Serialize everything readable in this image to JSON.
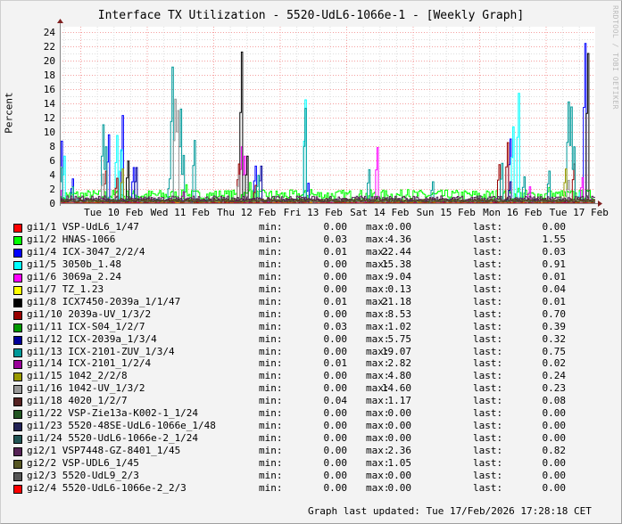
{
  "chart_data": {
    "type": "line",
    "title": "Interface TX Utilization - 5520-UdL6-1066e-1 - [Weekly Graph]",
    "ylabel": "Percent",
    "xlabel": "",
    "watermark": "RRDTOOL / TOBI OETIKER",
    "ylim": [
      0,
      25
    ],
    "yticks": [
      "0",
      "2",
      "4",
      "6",
      "8",
      "10",
      "12",
      "14",
      "16",
      "18",
      "20",
      "22",
      "24"
    ],
    "x_unit": "hours since Tue 10 Feb 00:00",
    "xlim": [
      -7.4,
      185.5
    ],
    "xticks": [
      {
        "label": "Tue 10 Feb",
        "hour": 12
      },
      {
        "label": "Wed 11 Feb",
        "hour": 36
      },
      {
        "label": "Thu 12 Feb",
        "hour": 60
      },
      {
        "label": "Fri 13 Feb",
        "hour": 84
      },
      {
        "label": "Sat 14 Feb",
        "hour": 108
      },
      {
        "label": "Sun 15 Feb",
        "hour": 132
      },
      {
        "label": "Mon 16 Feb",
        "hour": 156
      },
      {
        "label": "Tue 17 Feb",
        "hour": 180
      }
    ],
    "grid": true,
    "legend_placement": "bottom",
    "series": [
      {
        "name": "gi1/1 VSP-UdL6_1/47",
        "color": "#FF0000",
        "min": "0.00",
        "max": "0.00",
        "last": "0.00",
        "base": 0,
        "spikes": []
      },
      {
        "name": "gi1/2 HNAS-1066",
        "color": "#00FF00",
        "min": "0.03",
        "max": "4.36",
        "last": "1.55",
        "base": 1.1,
        "spikes": [
          [
            38,
            2.6
          ],
          [
            61,
            2.9
          ],
          [
            83,
            1.9
          ],
          [
            118,
            1.9
          ],
          [
            158,
            2.1
          ],
          [
            169,
            2.2
          ]
        ]
      },
      {
        "name": "gi1/4 ICX-3047_2/2/4",
        "color": "#0000FF",
        "min": "0.01",
        "max": "22.44",
        "last": "0.03",
        "base": 0.1,
        "spikes": [
          [
            -7,
            8.7
          ],
          [
            -3,
            3.4
          ],
          [
            10,
            9.6
          ],
          [
            15,
            12.3
          ],
          [
            19,
            5.0
          ],
          [
            63,
            5.2
          ],
          [
            82,
            2.8
          ],
          [
            155,
            9.0
          ],
          [
            182,
            22.4
          ]
        ]
      },
      {
        "name": "gi1/5 3050b_1.48",
        "color": "#00FFFF",
        "min": "0.00",
        "max": "15.38",
        "last": "0.91",
        "base": 0.1,
        "spikes": [
          [
            -6,
            6.6
          ],
          [
            13,
            9.5
          ],
          [
            14.5,
            7.5
          ],
          [
            81,
            14.5
          ],
          [
            156,
            10.7
          ],
          [
            158,
            15.4
          ],
          [
            180,
            1.5
          ]
        ]
      },
      {
        "name": "gi1/6 3069a_2.24",
        "color": "#FF00FF",
        "min": "0.00",
        "max": "9.04",
        "last": "0.01",
        "base": 0.2,
        "spikes": [
          [
            -7,
            1.8
          ],
          [
            58,
            7.9
          ],
          [
            59,
            6.6
          ],
          [
            107,
            7.8
          ],
          [
            162,
            2.3
          ],
          [
            181,
            3.6
          ]
        ]
      },
      {
        "name": "gi1/7 TZ_1.23",
        "color": "#FFFF00",
        "min": "0.00",
        "max": "0.13",
        "last": "0.04",
        "base": 0.05,
        "spikes": []
      },
      {
        "name": "gi1/8 ICX7450-2039a_1/1/47",
        "color": "#000000",
        "min": "0.01",
        "max": "21.18",
        "last": "0.01",
        "base": 0.2,
        "spikes": [
          [
            17,
            5.9
          ],
          [
            58,
            21.2
          ],
          [
            60,
            6.6
          ],
          [
            183,
            21.0
          ]
        ]
      },
      {
        "name": "gi1/10 2039a-UV_1/3/2",
        "color": "#990000",
        "min": "0.00",
        "max": "8.53",
        "last": "0.70",
        "base": 0.3,
        "spikes": [
          [
            9,
            4.5
          ],
          [
            13,
            3.5
          ],
          [
            57,
            5.5
          ],
          [
            63,
            2.5
          ],
          [
            151,
            5.4
          ],
          [
            154,
            8.5
          ],
          [
            178,
            5.5
          ]
        ]
      },
      {
        "name": "gi1/11 ICX-S04_1/2/7",
        "color": "#009900",
        "min": "0.03",
        "max": "1.02",
        "last": "0.39",
        "base": 0.35,
        "spikes": []
      },
      {
        "name": "gi1/12 ICX-2039a_1/3/4",
        "color": "#000099",
        "min": "0.00",
        "max": "5.75",
        "last": "0.32",
        "base": 0.3,
        "spikes": [
          [
            20,
            5.0
          ],
          [
            65,
            5.2
          ],
          [
            155,
            3.0
          ]
        ]
      },
      {
        "name": "gi1/13 ICX-2101-ZUV_1/3/4",
        "color": "#009999",
        "min": "0.00",
        "max": "19.07",
        "last": "0.75",
        "base": 0.3,
        "spikes": [
          [
            -7,
            5.0
          ],
          [
            -3,
            2.3
          ],
          [
            8,
            11.0
          ],
          [
            9,
            7.9
          ],
          [
            32,
            3.4
          ],
          [
            33,
            19.1
          ],
          [
            36,
            13.2
          ],
          [
            37,
            6.7
          ],
          [
            41,
            8.8
          ],
          [
            64,
            3.9
          ],
          [
            81,
            13.3
          ],
          [
            104,
            4.7
          ],
          [
            127,
            3.0
          ],
          [
            152,
            5.6
          ],
          [
            160,
            3.7
          ],
          [
            169,
            4.5
          ],
          [
            176,
            14.2
          ],
          [
            177,
            13.5
          ],
          [
            178,
            7.9
          ]
        ]
      },
      {
        "name": "gi1/14 ICX-2101_1/2/4",
        "color": "#990099",
        "min": "0.01",
        "max": "2.82",
        "last": "0.02",
        "base": 0.2,
        "spikes": [
          [
            37,
            1.6
          ]
        ]
      },
      {
        "name": "gi1/15 1042_2/2/8",
        "color": "#999900",
        "min": "0.00",
        "max": "4.80",
        "last": "0.24",
        "base": 0.25,
        "spikes": [
          [
            15,
            4.8
          ],
          [
            175,
            4.8
          ]
        ]
      },
      {
        "name": "gi1/16 1042-UV_1/3/2",
        "color": "#999999",
        "min": "0.00",
        "max": "14.60",
        "last": "0.23",
        "base": 0.3,
        "spikes": [
          [
            8,
            4.1
          ],
          [
            34,
            14.6
          ],
          [
            35,
            13.0
          ],
          [
            34.5,
            10.0
          ],
          [
            57,
            3.9
          ],
          [
            176,
            3.2
          ]
        ]
      },
      {
        "name": "gi1/18 4020_1/2/7",
        "color": "#552222",
        "min": "0.04",
        "max": "1.17",
        "last": "0.08",
        "base": 0.4,
        "spikes": []
      },
      {
        "name": "gi1/22 VSP-Zie13a-K002-1_1/24",
        "color": "#225522",
        "min": "0.00",
        "max": "0.00",
        "last": "0.00",
        "base": 0,
        "spikes": []
      },
      {
        "name": "gi1/23 5520-48SE-UdL6-1066e_1/48",
        "color": "#222255",
        "min": "0.00",
        "max": "0.00",
        "last": "0.00",
        "base": 0,
        "spikes": []
      },
      {
        "name": "gi1/24 5520-UdL6-1066e-2_1/24",
        "color": "#225555",
        "min": "0.00",
        "max": "0.00",
        "last": "0.00",
        "base": 0,
        "spikes": []
      },
      {
        "name": "gi2/1 VSP7448-GZ-8401_1/45",
        "color": "#552255",
        "min": "0.00",
        "max": "2.36",
        "last": "0.82",
        "base": 0.6,
        "spikes": []
      },
      {
        "name": "gi2/2 VSP-UDL6_1/45",
        "color": "#555522",
        "min": "0.00",
        "max": "1.05",
        "last": "0.00",
        "base": 0.3,
        "spikes": []
      },
      {
        "name": "gi2/3 5520-UdL9_2/3",
        "color": "#555555",
        "min": "0.00",
        "max": "0.00",
        "last": "0.00",
        "base": 0,
        "spikes": []
      },
      {
        "name": "gi2/4 5520-UdL6-1066e-2_2/3",
        "color": "#FF0000",
        "min": "0.00",
        "max": "0.00",
        "last": "0.00",
        "base": 0,
        "spikes": []
      }
    ]
  },
  "legend_labels": {
    "min": "min:",
    "max": "max:",
    "last": "last:"
  },
  "footer": "Graph last updated: Tue 17/Feb/2026 17:28:18 CET"
}
